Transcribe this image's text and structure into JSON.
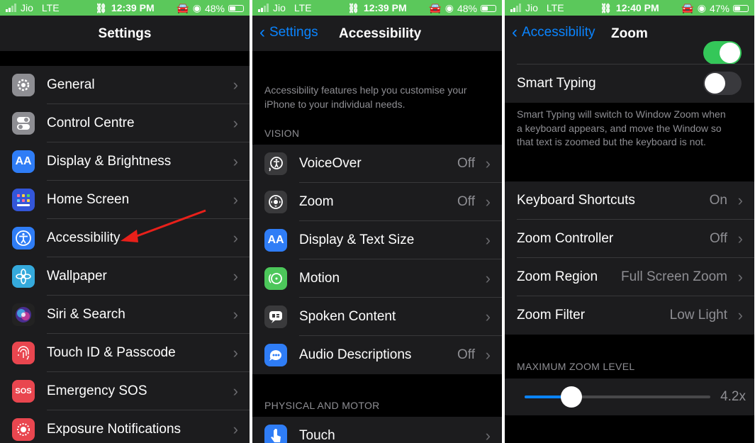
{
  "status_bars": [
    {
      "carrier": "Jio",
      "network": "LTE",
      "time": "12:39 PM",
      "battery": "48%",
      "battery_level": 0.48
    },
    {
      "carrier": "Jio",
      "network": "LTE",
      "time": "12:39 PM",
      "battery": "48%",
      "battery_level": 0.48
    },
    {
      "carrier": "Jio",
      "network": "LTE",
      "time": "12:40 PM",
      "battery": "47%",
      "battery_level": 0.47
    }
  ],
  "settings": {
    "title": "Settings",
    "items": [
      {
        "label": "General",
        "icon": "gear-icon",
        "color": "#8e8e93"
      },
      {
        "label": "Control Centre",
        "icon": "toggles-icon",
        "color": "#8e8e93"
      },
      {
        "label": "Display & Brightness",
        "icon": "text-size-icon",
        "glyph": "AA",
        "color": "#2f7df6"
      },
      {
        "label": "Home Screen",
        "icon": "home-grid-icon",
        "color": "#3356d9"
      },
      {
        "label": "Accessibility",
        "icon": "accessibility-icon",
        "color": "#2f7df6"
      },
      {
        "label": "Wallpaper",
        "icon": "flower-icon",
        "color": "#35aadc"
      },
      {
        "label": "Siri & Search",
        "icon": "siri-icon",
        "color": "#222"
      },
      {
        "label": "Touch ID & Passcode",
        "icon": "fingerprint-icon",
        "color": "#e9464f"
      },
      {
        "label": "Emergency SOS",
        "icon": "sos-icon",
        "glyph": "SOS",
        "color": "#e9464f"
      },
      {
        "label": "Exposure Notifications",
        "icon": "exposure-icon",
        "color": "#e9464f"
      }
    ]
  },
  "accessibility": {
    "back": "Settings",
    "title": "Accessibility",
    "description": "Accessibility features help you customise your iPhone to your individual needs.",
    "vision_header": "VISION",
    "vision_items": [
      {
        "label": "VoiceOver",
        "value": "Off",
        "icon": "voiceover-icon",
        "color": "#3a3a3c"
      },
      {
        "label": "Zoom",
        "value": "Off",
        "icon": "zoom-icon",
        "color": "#3a3a3c"
      },
      {
        "label": "Display & Text Size",
        "value": "",
        "icon": "text-size-icon",
        "glyph": "AA",
        "color": "#2f7df6"
      },
      {
        "label": "Motion",
        "value": "",
        "icon": "motion-icon",
        "color": "#4cc75a"
      },
      {
        "label": "Spoken Content",
        "value": "",
        "icon": "spoken-content-icon",
        "color": "#3a3a3c"
      },
      {
        "label": "Audio Descriptions",
        "value": "Off",
        "icon": "audio-description-icon",
        "color": "#2f7df6"
      }
    ],
    "physical_header": "PHYSICAL AND MOTOR",
    "physical_items": [
      {
        "label": "Touch",
        "value": "",
        "icon": "touch-icon",
        "color": "#2f7df6"
      }
    ]
  },
  "zoom": {
    "back": "Accessibility",
    "title": "Zoom",
    "smart_typing_label": "Smart Typing",
    "smart_typing_desc": "Smart Typing will switch to Window Zoom when a keyboard appears, and move the Window so that text is zoomed but the keyboard is not.",
    "items": [
      {
        "label": "Keyboard Shortcuts",
        "value": "On"
      },
      {
        "label": "Zoom Controller",
        "value": "Off"
      },
      {
        "label": "Zoom Region",
        "value": "Full Screen Zoom"
      },
      {
        "label": "Zoom Filter",
        "value": "Low Light"
      }
    ],
    "max_zoom_header": "MAXIMUM ZOOM LEVEL",
    "max_zoom_value": "4.2x",
    "max_zoom_fraction": 0.25
  },
  "colors": {
    "accent": "#0a84ff",
    "arrow": "#e8201a",
    "status_green": "#5bc85b"
  }
}
